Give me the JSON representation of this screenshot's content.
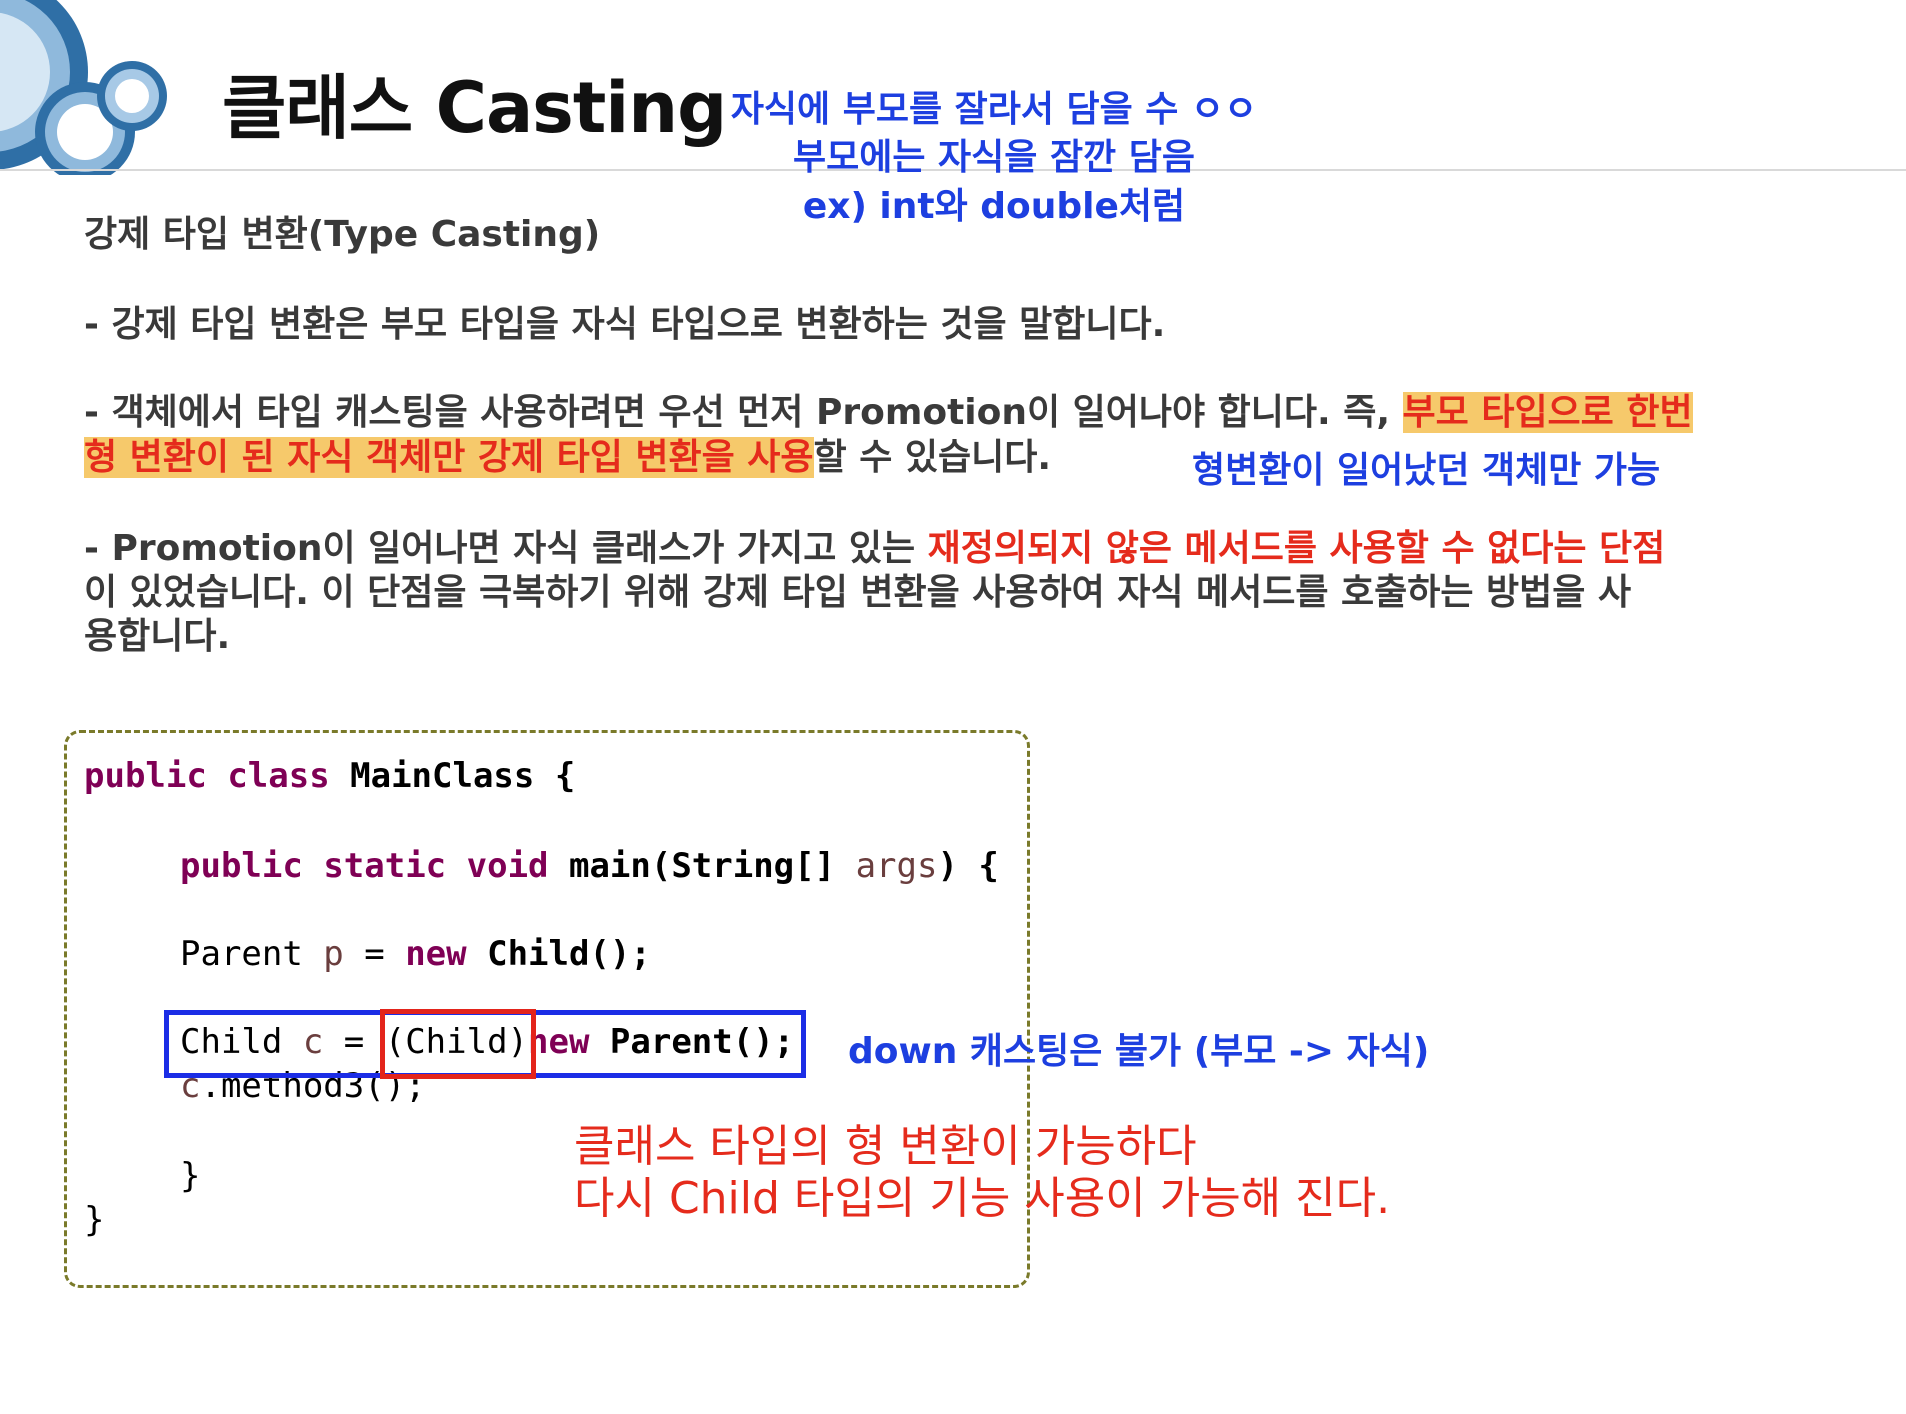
{
  "title": "클래스 Casting",
  "top_note": {
    "line1": "자식에 부모를 잘라서 담을 수 ㅇㅇ",
    "line2": "부모에는 자식을 잠깐 담음",
    "line3": "ex) int와 double처럼"
  },
  "heading": "강제 타입 변환(Type Casting)",
  "para1": "- 강제 타입 변환은 부모 타입을 자식 타입으로 변환하는 것을 말합니다.",
  "para2": {
    "line1_plain": "- 객체에서 타입 캐스팅을 사용하려면 우선 먼저 Promotion이 일어나야 합니다. 즉, ",
    "line1_highlight": "부모 타입으로 한번",
    "line2_highlight": "형 변환이 된 자식 객체만 강제 타입 변환을 사용",
    "line2_plain": "할 수 있습니다."
  },
  "para2_note": "형변환이 일어났던 객체만 가능",
  "para3": {
    "line1_plain": "- Promotion이 일어나면 자식 클래스가 가지고 있는 ",
    "line1_red": "재정의되지 않은 메서드를 사용할 수 없다는 단점",
    "line2": "이 있었습니다. 이 단점을 극복하기 위해 강제 타입 변환을 사용하여 자식 메서드를 호출하는 방법을 사",
    "line3": "용합니다."
  },
  "code": {
    "l1_kw1": "public",
    "l1_kw2": "class",
    "l1_rest": " MainClass {",
    "l2_kw1": "public",
    "l2_kw2": "static",
    "l2_kw3": "void",
    "l2_method": " main(String[] ",
    "l2_var": "args",
    "l2_end": ") {",
    "l3_type": "Parent ",
    "l3_var": "p",
    "l3_eq": " = ",
    "l3_new": "new",
    "l3_rest": " Child();",
    "l4_type": "Child ",
    "l4_var": "c",
    "l4_eq": " = ",
    "l4_cast": "(Child)",
    "l4_new": "new",
    "l4_rest": " Parent();",
    "l5_var": "c",
    "l5_rest": ".method3();",
    "l6": "}",
    "l7": "}"
  },
  "down_note": "down 캐스팅은 불가 (부모 -> 자식)",
  "red_note": {
    "line1": "클래스 타입의 형 변환이 가능하다",
    "line2": "다시 Child 타입의 기능 사용이 가능해 진다."
  }
}
